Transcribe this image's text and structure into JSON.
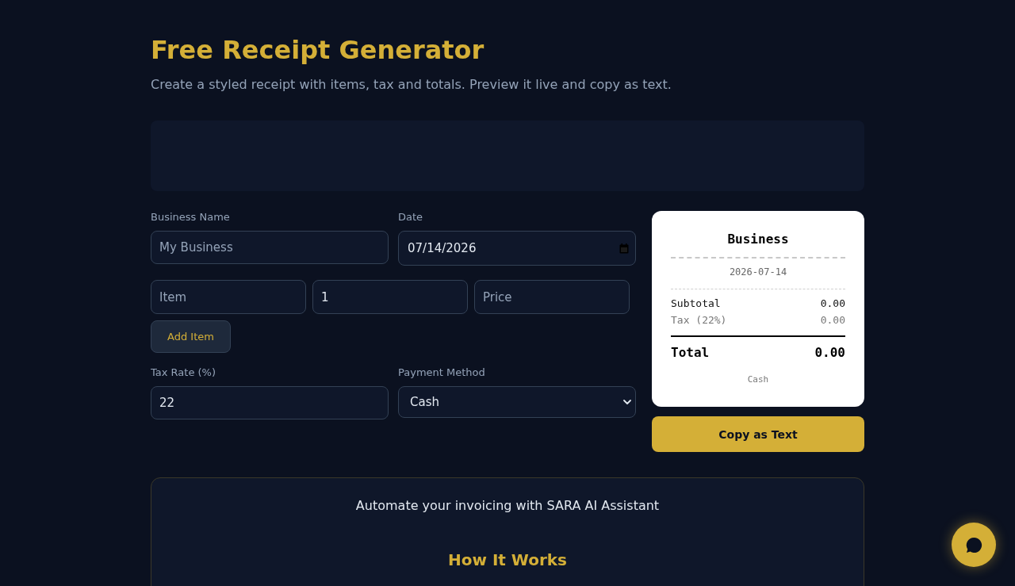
{
  "header": {
    "title": "Free Receipt Generator",
    "subtitle": "Create a styled receipt with items, tax and totals. Preview it live and copy as text."
  },
  "form": {
    "business_name": {
      "label": "Business Name",
      "placeholder": "My Business"
    },
    "date": {
      "label": "Date",
      "value": "07/14/2026"
    },
    "item_entry": {
      "item": {
        "placeholder": "Item"
      },
      "quantity": {
        "value": "1"
      },
      "price": {
        "placeholder": "Price"
      }
    },
    "add_item_button": "Add Item",
    "tax_rate": {
      "label": "Tax Rate (%)",
      "value": "22"
    },
    "payment_method": {
      "label": "Payment Method",
      "value": "Cash"
    }
  },
  "receipt": {
    "business_name": "Business",
    "date": "2026-07-14",
    "lines": [
      {
        "kind": "subtotal",
        "label": "Subtotal",
        "value": "0.00"
      },
      {
        "kind": "tax",
        "label": "Tax (22%)",
        "value": "0.00"
      }
    ],
    "total": {
      "label": "Total",
      "value": "0.00"
    },
    "payment_method": "Cash"
  },
  "copy_button": "Copy as Text",
  "promo": {
    "text": "Automate your invoicing with SARA AI Assistant",
    "heading": "How It Works"
  }
}
